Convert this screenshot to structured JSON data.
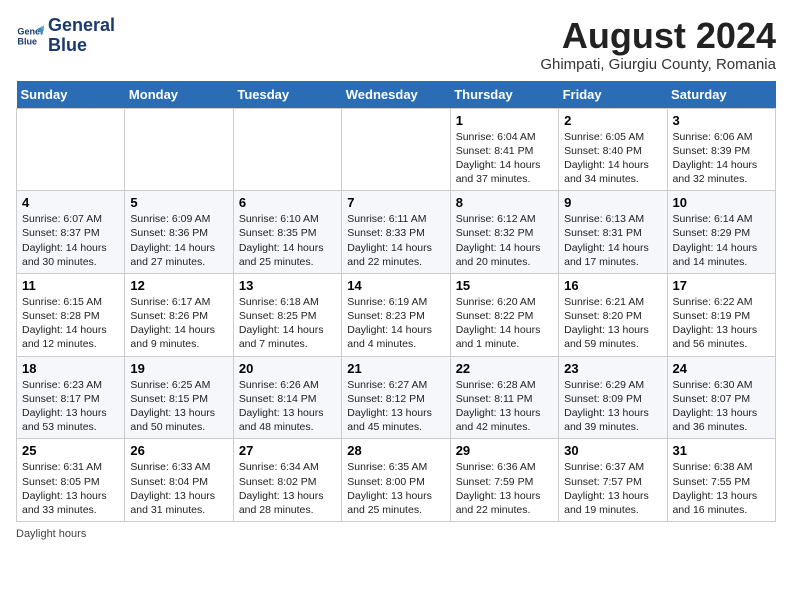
{
  "header": {
    "logo_line1": "General",
    "logo_line2": "Blue",
    "month_year": "August 2024",
    "location": "Ghimpati, Giurgiu County, Romania"
  },
  "weekdays": [
    "Sunday",
    "Monday",
    "Tuesday",
    "Wednesday",
    "Thursday",
    "Friday",
    "Saturday"
  ],
  "weeks": [
    [
      {
        "num": "",
        "detail": ""
      },
      {
        "num": "",
        "detail": ""
      },
      {
        "num": "",
        "detail": ""
      },
      {
        "num": "",
        "detail": ""
      },
      {
        "num": "1",
        "detail": "Sunrise: 6:04 AM\nSunset: 8:41 PM\nDaylight: 14 hours and 37 minutes."
      },
      {
        "num": "2",
        "detail": "Sunrise: 6:05 AM\nSunset: 8:40 PM\nDaylight: 14 hours and 34 minutes."
      },
      {
        "num": "3",
        "detail": "Sunrise: 6:06 AM\nSunset: 8:39 PM\nDaylight: 14 hours and 32 minutes."
      }
    ],
    [
      {
        "num": "4",
        "detail": "Sunrise: 6:07 AM\nSunset: 8:37 PM\nDaylight: 14 hours and 30 minutes."
      },
      {
        "num": "5",
        "detail": "Sunrise: 6:09 AM\nSunset: 8:36 PM\nDaylight: 14 hours and 27 minutes."
      },
      {
        "num": "6",
        "detail": "Sunrise: 6:10 AM\nSunset: 8:35 PM\nDaylight: 14 hours and 25 minutes."
      },
      {
        "num": "7",
        "detail": "Sunrise: 6:11 AM\nSunset: 8:33 PM\nDaylight: 14 hours and 22 minutes."
      },
      {
        "num": "8",
        "detail": "Sunrise: 6:12 AM\nSunset: 8:32 PM\nDaylight: 14 hours and 20 minutes."
      },
      {
        "num": "9",
        "detail": "Sunrise: 6:13 AM\nSunset: 8:31 PM\nDaylight: 14 hours and 17 minutes."
      },
      {
        "num": "10",
        "detail": "Sunrise: 6:14 AM\nSunset: 8:29 PM\nDaylight: 14 hours and 14 minutes."
      }
    ],
    [
      {
        "num": "11",
        "detail": "Sunrise: 6:15 AM\nSunset: 8:28 PM\nDaylight: 14 hours and 12 minutes."
      },
      {
        "num": "12",
        "detail": "Sunrise: 6:17 AM\nSunset: 8:26 PM\nDaylight: 14 hours and 9 minutes."
      },
      {
        "num": "13",
        "detail": "Sunrise: 6:18 AM\nSunset: 8:25 PM\nDaylight: 14 hours and 7 minutes."
      },
      {
        "num": "14",
        "detail": "Sunrise: 6:19 AM\nSunset: 8:23 PM\nDaylight: 14 hours and 4 minutes."
      },
      {
        "num": "15",
        "detail": "Sunrise: 6:20 AM\nSunset: 8:22 PM\nDaylight: 14 hours and 1 minute."
      },
      {
        "num": "16",
        "detail": "Sunrise: 6:21 AM\nSunset: 8:20 PM\nDaylight: 13 hours and 59 minutes."
      },
      {
        "num": "17",
        "detail": "Sunrise: 6:22 AM\nSunset: 8:19 PM\nDaylight: 13 hours and 56 minutes."
      }
    ],
    [
      {
        "num": "18",
        "detail": "Sunrise: 6:23 AM\nSunset: 8:17 PM\nDaylight: 13 hours and 53 minutes."
      },
      {
        "num": "19",
        "detail": "Sunrise: 6:25 AM\nSunset: 8:15 PM\nDaylight: 13 hours and 50 minutes."
      },
      {
        "num": "20",
        "detail": "Sunrise: 6:26 AM\nSunset: 8:14 PM\nDaylight: 13 hours and 48 minutes."
      },
      {
        "num": "21",
        "detail": "Sunrise: 6:27 AM\nSunset: 8:12 PM\nDaylight: 13 hours and 45 minutes."
      },
      {
        "num": "22",
        "detail": "Sunrise: 6:28 AM\nSunset: 8:11 PM\nDaylight: 13 hours and 42 minutes."
      },
      {
        "num": "23",
        "detail": "Sunrise: 6:29 AM\nSunset: 8:09 PM\nDaylight: 13 hours and 39 minutes."
      },
      {
        "num": "24",
        "detail": "Sunrise: 6:30 AM\nSunset: 8:07 PM\nDaylight: 13 hours and 36 minutes."
      }
    ],
    [
      {
        "num": "25",
        "detail": "Sunrise: 6:31 AM\nSunset: 8:05 PM\nDaylight: 13 hours and 33 minutes."
      },
      {
        "num": "26",
        "detail": "Sunrise: 6:33 AM\nSunset: 8:04 PM\nDaylight: 13 hours and 31 minutes."
      },
      {
        "num": "27",
        "detail": "Sunrise: 6:34 AM\nSunset: 8:02 PM\nDaylight: 13 hours and 28 minutes."
      },
      {
        "num": "28",
        "detail": "Sunrise: 6:35 AM\nSunset: 8:00 PM\nDaylight: 13 hours and 25 minutes."
      },
      {
        "num": "29",
        "detail": "Sunrise: 6:36 AM\nSunset: 7:59 PM\nDaylight: 13 hours and 22 minutes."
      },
      {
        "num": "30",
        "detail": "Sunrise: 6:37 AM\nSunset: 7:57 PM\nDaylight: 13 hours and 19 minutes."
      },
      {
        "num": "31",
        "detail": "Sunrise: 6:38 AM\nSunset: 7:55 PM\nDaylight: 13 hours and 16 minutes."
      }
    ]
  ],
  "footer": {
    "label": "Daylight hours"
  }
}
